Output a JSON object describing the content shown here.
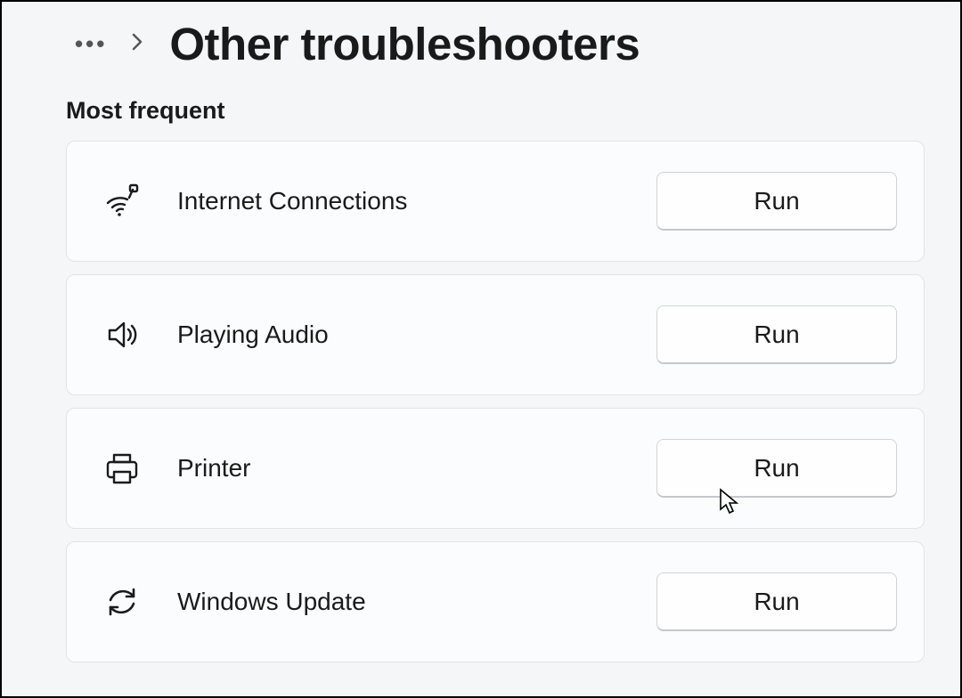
{
  "header": {
    "title": "Other troubleshooters"
  },
  "section_label": "Most frequent",
  "run_label": "Run",
  "items": [
    {
      "label": "Internet Connections",
      "icon": "wifi-icon"
    },
    {
      "label": "Playing Audio",
      "icon": "speaker-icon"
    },
    {
      "label": "Printer",
      "icon": "printer-icon"
    },
    {
      "label": "Windows Update",
      "icon": "refresh-icon"
    }
  ]
}
